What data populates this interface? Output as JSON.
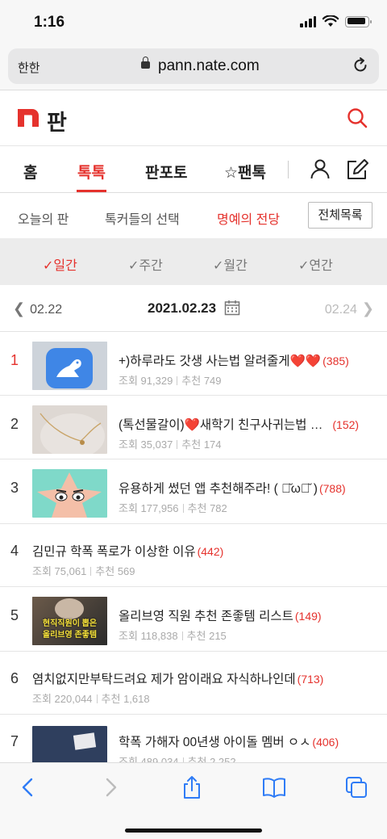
{
  "status": {
    "time": "1:16"
  },
  "browser": {
    "aa_label": "한한",
    "domain": "pann.nate.com"
  },
  "site": {
    "logo_text": "판"
  },
  "main_tabs": [
    {
      "label": "홈"
    },
    {
      "label": "톡톡"
    },
    {
      "label": "판포토"
    },
    {
      "label": "☆팬톡"
    }
  ],
  "sub_tabs": [
    {
      "label": "오늘의 판"
    },
    {
      "label": "톡커들의 선택"
    },
    {
      "label": "명예의 전당"
    }
  ],
  "all_list_label": "전체목록",
  "periods": [
    {
      "label": "✓일간"
    },
    {
      "label": "✓주간"
    },
    {
      "label": "✓월간"
    },
    {
      "label": "✓연간"
    }
  ],
  "date_nav": {
    "prev": "02.22",
    "current": "2021.02.23",
    "next": "02.24"
  },
  "posts": [
    {
      "rank": "1",
      "title": "+)하루라도 갓생 사는법 알려줄게❤️❤️",
      "comments": "(385)",
      "views": "조회 91,329",
      "recommends": "추천 749",
      "thumb": "blue-app-icon"
    },
    {
      "rank": "2",
      "title": "(톡선물갈이)❤️새학기 친구사귀는법 …",
      "comments": "(152)",
      "views": "조회 35,037",
      "recommends": "추천 174",
      "thumb": "necklace-photo"
    },
    {
      "rank": "3",
      "title": "유용하게 썼던 앱 추천해주라! ( ･̆ω･̆ )",
      "comments": "(788)",
      "views": "조회 177,956",
      "recommends": "추천 782",
      "thumb": "cartoon-star"
    },
    {
      "rank": "4",
      "title": "김민규 학폭 폭로가 이상한 이유",
      "comments": "(442)",
      "views": "조회 75,061",
      "recommends": "추천 569",
      "thumb": ""
    },
    {
      "rank": "5",
      "title": "올리브영 직원 추천 존좋템 리스트",
      "comments": "(149)",
      "views": "조회 118,838",
      "recommends": "추천 215",
      "thumb": "oliveyoung-thumbnail"
    },
    {
      "rank": "6",
      "title": "염치없지만부탁드려요 제가 암이래요 자식하나인데",
      "comments": "(713)",
      "views": "조회 220,044",
      "recommends": "추천 1,618",
      "thumb": ""
    },
    {
      "rank": "7",
      "title": "학폭 가해자 00년생 아이돌 멤버 ㅇㅅ",
      "comments": "(406)",
      "views": "조회 489,034",
      "recommends": "추천 2,252",
      "thumb": "denim-photo"
    }
  ],
  "thumb_text": {
    "line1": "현직직원이 뽑은",
    "line2": "올리브영 존좋템"
  },
  "colors": {
    "accent": "#e5322d",
    "text": "#222222",
    "muted": "#aaaaaa",
    "ios_blue": "#2f7cf6"
  }
}
